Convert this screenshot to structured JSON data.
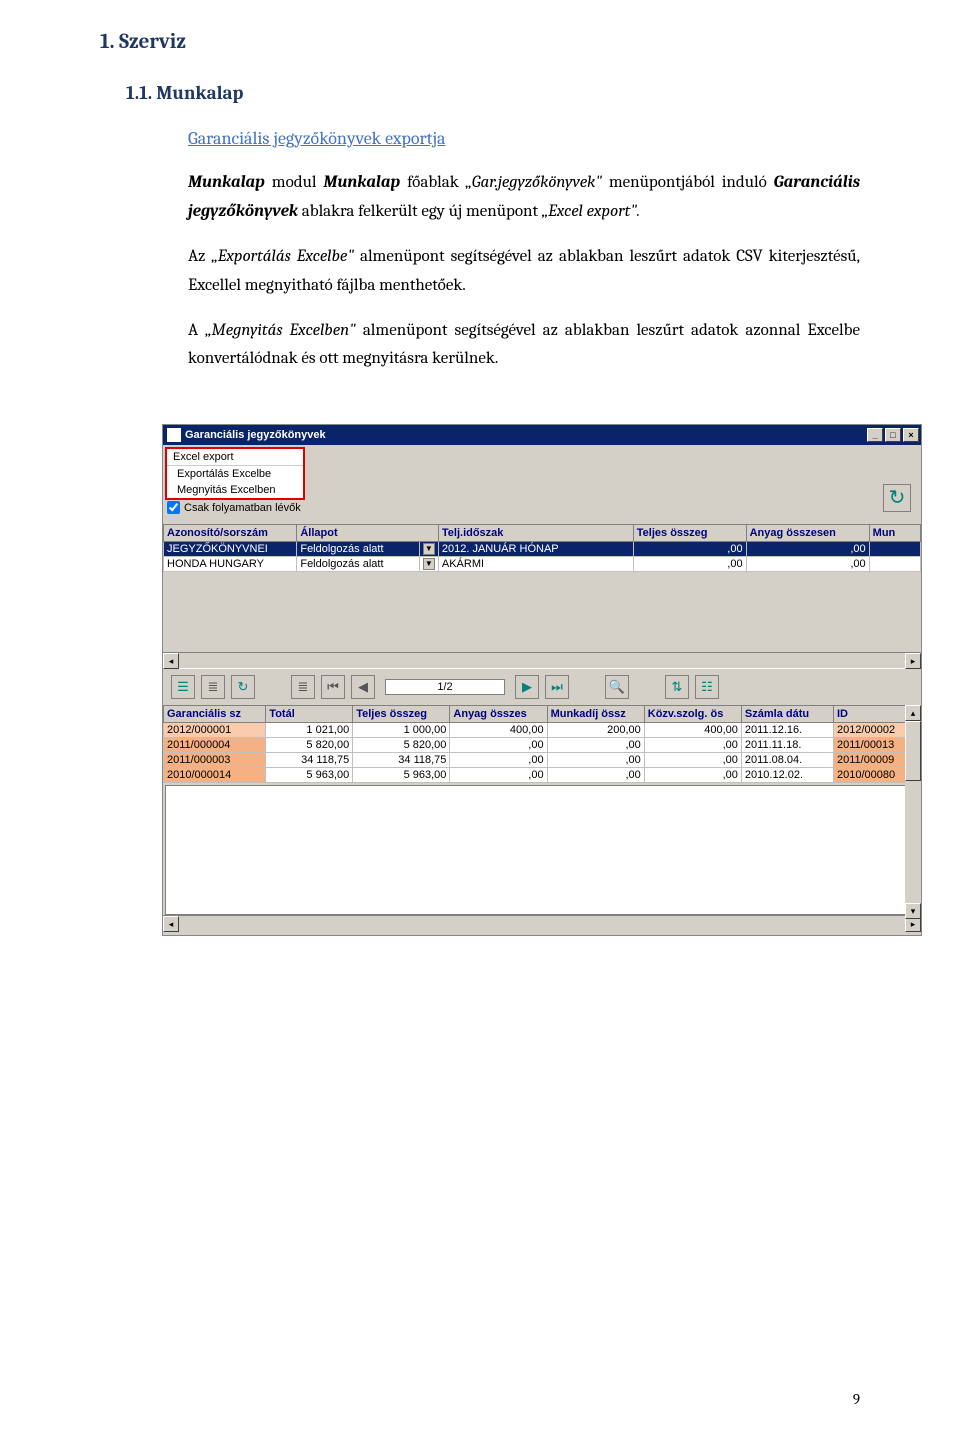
{
  "heading1": "1.  Szerviz",
  "heading2": "1.1.  Munkalap",
  "heading3": "Garanciális jegyzőkönyvek exportja",
  "para1_a": "Munkalap",
  "para1_b": " modul ",
  "para1_c": "Munkalap",
  "para1_d": " főablak ",
  "para1_e": "„Gar.jegyzőkönyvek\"",
  "para1_f": " menüpontjából induló ",
  "para1_g": "Garanciális jegyzőkönyvek",
  "para1_h": " ablakra felkerült egy új menüpont ",
  "para1_i": "„Excel export\".",
  "para2_a": "Az ",
  "para2_b": "„Exportálás Excelbe\"",
  "para2_c": " almenüpont segítségével az ablakban leszűrt adatok CSV kiterjesztésű, Excellel megnyitható fájlba menthetőek.",
  "para3_a": "A ",
  "para3_b": "„Megnyitás Excelben\"",
  "para3_c": " almenüpont segítségével az ablakban leszűrt adatok azonnal Excelbe konvertálódnak és ott megnyitásra kerülnek.",
  "screenshot": {
    "title": "Garanciális jegyzőkönyvek",
    "win_min": "_",
    "win_max": "□",
    "win_close": "×",
    "menu_top": "Excel export",
    "menu_item1": "Exportálás Excelbe",
    "menu_item2": "Megnyitás Excelben",
    "checkbox_label": "Csak folyamatban lévők",
    "pager": "1/2",
    "grid1": {
      "headers": [
        "Azonosító/sorszám",
        "Állapot",
        "",
        "Telj.időszak",
        "Teljes összeg",
        "Anyag összesen",
        "Mun"
      ],
      "rows": [
        [
          "JEGYZŐKÖNYVNEI",
          "Feldolgozás alatt",
          "▼",
          "2012. JANUÁR HÓNAP",
          ",00",
          ",00",
          ""
        ],
        [
          "HONDA HUNGARY",
          "Feldolgozás alatt",
          "▼",
          "AKÁRMI",
          ",00",
          ",00",
          ""
        ]
      ]
    },
    "grid2": {
      "headers": [
        "Garanciális sz",
        "Totál",
        "Teljes összeg",
        "Anyag összes",
        "Munkadíj össz",
        "Közv.szolg. ös",
        "Számla dátu",
        "ID"
      ],
      "rows": [
        [
          "2012/000001",
          "1 021,00",
          "1 000,00",
          "400,00",
          "200,00",
          "400,00",
          "2011.12.16.",
          "2012/00002"
        ],
        [
          "2011/000004",
          "5 820,00",
          "5 820,00",
          ",00",
          ",00",
          ",00",
          "2011.11.18.",
          "2011/00013"
        ],
        [
          "2011/000003",
          "34 118,75",
          "34 118,75",
          ",00",
          ",00",
          ",00",
          "2011.08.04.",
          "2011/00009"
        ],
        [
          "2010/000014",
          "5 963,00",
          "5 963,00",
          ",00",
          ",00",
          ",00",
          "2010.12.02.",
          "2010/00080"
        ]
      ]
    }
  },
  "page_number": "9"
}
